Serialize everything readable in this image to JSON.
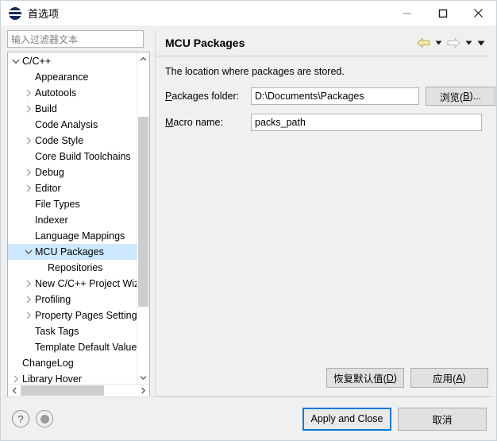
{
  "window": {
    "title": "首选项",
    "icon": "preferences-icon",
    "minimize_label": "—",
    "maximize_label": "□",
    "close_label": "✕"
  },
  "filter": {
    "placeholder": "输入过滤器文本",
    "value": ""
  },
  "tree": {
    "items": [
      {
        "label": "C/C++",
        "indent": 0,
        "twisty": "expanded"
      },
      {
        "label": "Appearance",
        "indent": 1,
        "twisty": "none"
      },
      {
        "label": "Autotools",
        "indent": 1,
        "twisty": "collapsed"
      },
      {
        "label": "Build",
        "indent": 1,
        "twisty": "collapsed"
      },
      {
        "label": "Code Analysis",
        "indent": 1,
        "twisty": "none"
      },
      {
        "label": "Code Style",
        "indent": 1,
        "twisty": "collapsed"
      },
      {
        "label": "Core Build Toolchains",
        "indent": 1,
        "twisty": "none"
      },
      {
        "label": "Debug",
        "indent": 1,
        "twisty": "collapsed"
      },
      {
        "label": "Editor",
        "indent": 1,
        "twisty": "collapsed"
      },
      {
        "label": "File Types",
        "indent": 1,
        "twisty": "none"
      },
      {
        "label": "Indexer",
        "indent": 1,
        "twisty": "none"
      },
      {
        "label": "Language Mappings",
        "indent": 1,
        "twisty": "none"
      },
      {
        "label": "MCU Packages",
        "indent": 1,
        "twisty": "expanded",
        "selected": true
      },
      {
        "label": "Repositories",
        "indent": 2,
        "twisty": "none"
      },
      {
        "label": "New C/C++ Project Wizard",
        "indent": 1,
        "twisty": "collapsed"
      },
      {
        "label": "Profiling",
        "indent": 1,
        "twisty": "collapsed"
      },
      {
        "label": "Property Pages Settings",
        "indent": 1,
        "twisty": "collapsed"
      },
      {
        "label": "Task Tags",
        "indent": 1,
        "twisty": "none"
      },
      {
        "label": "Template Default Values",
        "indent": 1,
        "twisty": "none"
      },
      {
        "label": "ChangeLog",
        "indent": 0,
        "twisty": "none"
      },
      {
        "label": "Library Hover",
        "indent": 0,
        "twisty": "collapsed"
      }
    ]
  },
  "page": {
    "title": "MCU Packages",
    "nav": {
      "back": "back-arrow",
      "back_menu": "back-dropdown",
      "forward": "forward-arrow",
      "forward_menu": "forward-dropdown",
      "view_menu": "view-menu"
    },
    "description": "The location where packages are stored.",
    "fields": [
      {
        "label_prefix": "P",
        "label_rest": "ackages folder:",
        "value": "D:\\Documents\\Packages",
        "name": "packages-folder"
      },
      {
        "label_prefix": "M",
        "label_rest": "acro name:",
        "value": "packs_path",
        "name": "macro-name"
      }
    ],
    "browse_button": {
      "prefix": "浏览(",
      "mnemonic": "B",
      "suffix": ")..."
    },
    "restore_defaults_button": {
      "prefix": "恢复默认值(",
      "mnemonic": "D",
      "suffix": ")"
    },
    "apply_button": {
      "prefix": "应用(",
      "mnemonic": "A",
      "suffix": ")"
    }
  },
  "footer": {
    "help_icon": "?",
    "status_icon": "info-dot-icon",
    "apply_and_close": "Apply and Close",
    "cancel": "取消"
  },
  "colors": {
    "selection": "#cde8ff",
    "focus_border": "#0078d7",
    "back_arrow": "#f2e6a0",
    "dialog_bg": "#f0f0f0"
  }
}
